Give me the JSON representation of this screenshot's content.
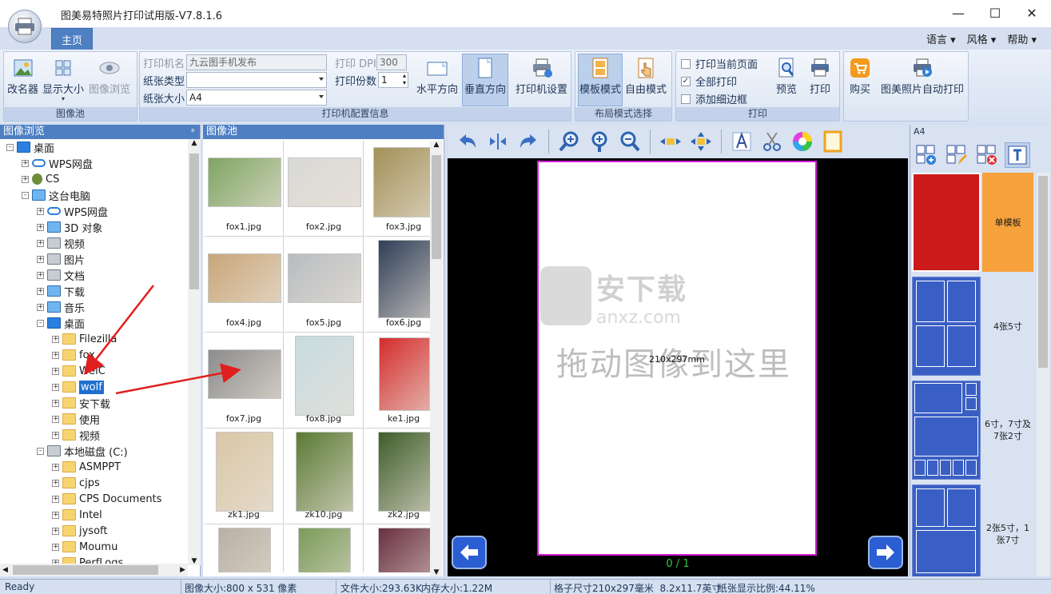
{
  "window": {
    "title": "图美易特照片打印试用版-V7.8.1.6",
    "minimize": "—",
    "maximize": "☐",
    "close": "✕"
  },
  "tabs": {
    "home": "主页"
  },
  "menu": {
    "language": "语言",
    "style": "风格",
    "help": "帮助"
  },
  "ribbon": {
    "image_pool": {
      "title": "图像池",
      "rename": "改名器",
      "display_size": "显示大小",
      "image_browse": "图像浏览"
    },
    "printer_config": {
      "title": "打印机配置信息",
      "printer_name_label": "打印机名",
      "printer_name_value": "九云图手机发布",
      "paper_type_label": "纸张类型",
      "paper_type_value": "",
      "paper_size_label": "纸张大小",
      "paper_size_value": "A4",
      "dpi_label": "打印 DPI",
      "dpi_value": "300",
      "copies_label": "打印份数",
      "copies_value": "1",
      "landscape": "水平方向",
      "portrait": "垂直方向",
      "printer_settings": "打印机设置"
    },
    "layout_mode": {
      "title": "布局模式选择",
      "template_mode": "模板模式",
      "free_mode": "自由模式"
    },
    "print": {
      "title": "打印",
      "print_current": "打印当前页面",
      "print_all": "全部打印",
      "add_border": "添加细边框",
      "preview": "预览",
      "print": "打印"
    },
    "extra": {
      "buy": "购买",
      "auto_print": "图美照片自动打印"
    }
  },
  "left_panel": {
    "title": "图像浏览",
    "pin": "ᵖ",
    "tree": [
      {
        "label": "桌面",
        "icon": "desk",
        "level": 0,
        "exp": "-"
      },
      {
        "label": "WPS网盘",
        "icon": "cloud",
        "level": 1,
        "exp": "+"
      },
      {
        "label": "CS",
        "icon": "user",
        "level": 1,
        "exp": "+"
      },
      {
        "label": "这台电脑",
        "icon": "pc",
        "level": 1,
        "exp": "-"
      },
      {
        "label": "WPS网盘",
        "icon": "cloud",
        "level": 2,
        "exp": "+"
      },
      {
        "label": "3D 对象",
        "icon": "pc",
        "level": 2,
        "exp": "+"
      },
      {
        "label": "视频",
        "icon": "disk",
        "level": 2,
        "exp": "+"
      },
      {
        "label": "图片",
        "icon": "disk",
        "level": 2,
        "exp": "+"
      },
      {
        "label": "文档",
        "icon": "disk",
        "level": 2,
        "exp": "+"
      },
      {
        "label": "下载",
        "icon": "pc",
        "level": 2,
        "exp": "+"
      },
      {
        "label": "音乐",
        "icon": "pc",
        "level": 2,
        "exp": "+"
      },
      {
        "label": "桌面",
        "icon": "desk",
        "level": 2,
        "exp": "-"
      },
      {
        "label": "Filezilla",
        "icon": "folder",
        "level": 3,
        "exp": "+"
      },
      {
        "label": "fox",
        "icon": "folder",
        "level": 3,
        "exp": "+"
      },
      {
        "label": "WeiC",
        "icon": "folder",
        "level": 3,
        "exp": "+"
      },
      {
        "label": "wolf",
        "icon": "folder",
        "level": 3,
        "exp": "+",
        "selected": true
      },
      {
        "label": "安下载",
        "icon": "folder",
        "level": 3,
        "exp": "+"
      },
      {
        "label": "使用",
        "icon": "folder",
        "level": 3,
        "exp": "+"
      },
      {
        "label": "视频",
        "icon": "folder",
        "level": 3,
        "exp": "+"
      },
      {
        "label": "本地磁盘 (C:)",
        "icon": "disk",
        "level": 2,
        "exp": "-"
      },
      {
        "label": "ASMPPT",
        "icon": "folder",
        "level": 3,
        "exp": "+"
      },
      {
        "label": "cjps",
        "icon": "folder",
        "level": 3,
        "exp": "+"
      },
      {
        "label": "CPS Documents",
        "icon": "folder",
        "level": 3,
        "exp": "+"
      },
      {
        "label": "Intel",
        "icon": "folder",
        "level": 3,
        "exp": "+"
      },
      {
        "label": "jysoft",
        "icon": "folder",
        "level": 3,
        "exp": "+"
      },
      {
        "label": "Moumu",
        "icon": "folder",
        "level": 3,
        "exp": "+"
      },
      {
        "label": "PerfLogs",
        "icon": "folder",
        "level": 3,
        "exp": "+"
      }
    ]
  },
  "mid_panel": {
    "title": "图像池",
    "images": [
      {
        "name": "fox1.jpg",
        "color": "#7fa562"
      },
      {
        "name": "fox2.jpg",
        "color": "#d9d9d6"
      },
      {
        "name": "fox3.jpg",
        "color": "#a39158"
      },
      {
        "name": "fox4.jpg",
        "color": "#c9a678"
      },
      {
        "name": "fox5.jpg",
        "color": "#b8bcc0"
      },
      {
        "name": "fox6.jpg",
        "color": "#2f3e57"
      },
      {
        "name": "fox7.jpg",
        "color": "#8c8c8c"
      },
      {
        "name": "fox8.jpg",
        "color": "#c7dbe0"
      },
      {
        "name": "ke1.jpg",
        "color": "#d42c2c"
      },
      {
        "name": "zk1.jpg",
        "color": "#d9c7a6"
      },
      {
        "name": "zk10.jpg",
        "color": "#5b7a35"
      },
      {
        "name": "zk2.jpg",
        "color": "#3f5e2a"
      },
      {
        "name": "",
        "color": "#b8b0a4"
      },
      {
        "name": "",
        "color": "#7c9b5a"
      },
      {
        "name": "",
        "color": "#6a3040"
      }
    ]
  },
  "canvas": {
    "paper_size_text": "210x297mm",
    "drop_hint": "拖动图像到这里",
    "watermark_name": "安下载",
    "watermark_url": "anxz.com",
    "page_counter": "0 / 1",
    "accent": "#d81bd8"
  },
  "right_panel": {
    "header": "A4",
    "templates": [
      {
        "label": "单模板"
      },
      {
        "label": "4张5寸"
      },
      {
        "label": "6寸，7寸及7张2寸"
      },
      {
        "label": "2张5寸，1张7寸"
      }
    ]
  },
  "status": {
    "ready": "Ready",
    "image_size": "图像大小:800 x 531 像素",
    "file_size": "文件大小:293.63K",
    "mem_size": "内存大小:1.22M",
    "grid_size": "格子尺寸210x297毫米  8.2x11.7英寸",
    "paper_ratio": "纸张显示比例:44.11%"
  }
}
